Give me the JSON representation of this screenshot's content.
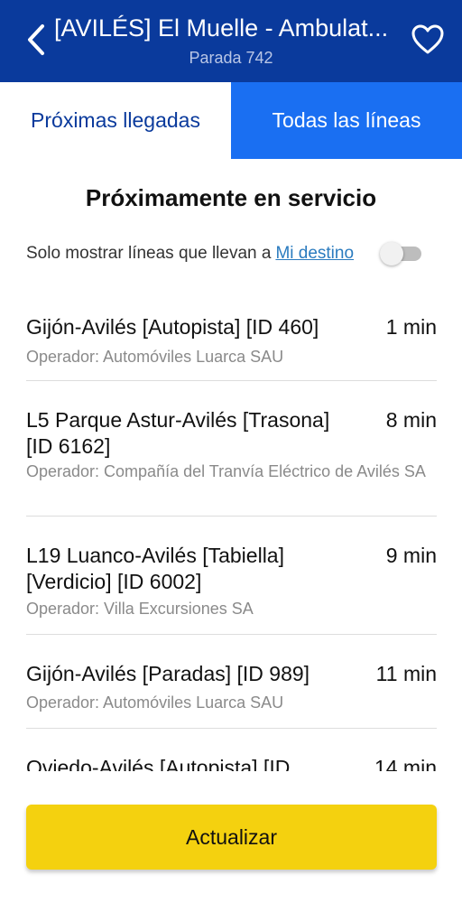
{
  "header": {
    "title": "[AVILÉS]  El Muelle - Ambulat...",
    "subtitle": "Parada 742",
    "back_icon": "chevron-left-icon",
    "favorite_icon": "heart-outline-icon"
  },
  "tabs": [
    {
      "label": "Próximas llegadas",
      "active": false
    },
    {
      "label": "Todas las líneas",
      "active": true
    }
  ],
  "section_title": "Próximamente en servicio",
  "filter": {
    "text": "Solo mostrar líneas que llevan a",
    "link": "Mi destino",
    "toggle_on": false
  },
  "arrivals": [
    {
      "name": "Gijón-Avilés [Autopista] [ID 460]",
      "time": "1 min",
      "operator": "Operador: Automóviles Luarca SAU"
    },
    {
      "name": "L5 Parque Astur-Avilés [Trasona] [ID 6162]",
      "time": "8 min",
      "operator": "Operador: Compañía del Tranvía Eléctrico de Avilés SA"
    },
    {
      "name": "L19 Luanco-Avilés [Tabiella] [Verdicio] [ID 6002]",
      "time": "9 min",
      "operator": "Operador: Villa Excursiones SA"
    },
    {
      "name": "Gijón-Avilés [Paradas] [ID 989]",
      "time": "11 min",
      "operator": "Operador: Automóviles Luarca SAU"
    },
    {
      "name": "Oviedo-Avilés [Autopista] [ID",
      "time": "14 min",
      "operator": ""
    }
  ],
  "update_button": "Actualizar",
  "colors": {
    "header_bg": "#0a3a9c",
    "active_tab_bg": "#1a6ff2",
    "button_bg": "#f4d10f",
    "link": "#2a7bbf"
  }
}
